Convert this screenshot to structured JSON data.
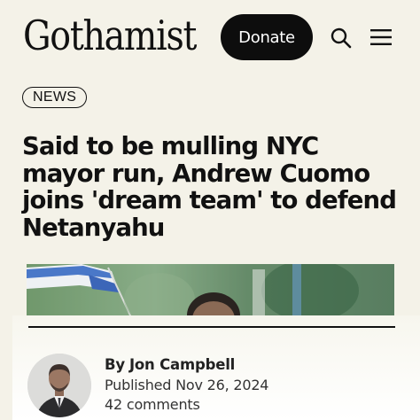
{
  "header": {
    "logo_text": "Gothamist",
    "donate_label": "Donate",
    "icons": [
      "search-icon",
      "menu-icon"
    ]
  },
  "article": {
    "category_badge": "NEWS",
    "headline": "Said to be mulling NYC mayor run, Andrew Cuomo joins 'dream team' to defend Netanyahu",
    "byline_prefix": "By",
    "author": "Jon Campbell",
    "published": "Published Nov 26, 2024",
    "comments": "42 comments"
  },
  "colors": {
    "background": "#f4f2e8",
    "donate_bg": "#0d0d0d",
    "text": "#111111"
  }
}
